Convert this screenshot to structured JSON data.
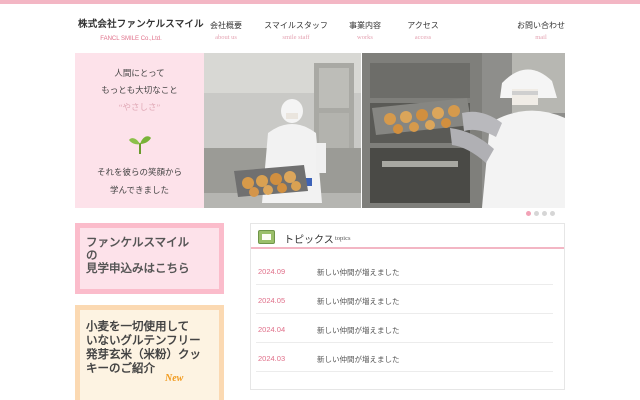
{
  "header": {
    "company_ja": "株式会社ファンケルスマイル",
    "company_en": "FANCL SMILE Co.,Ltd.",
    "nav": [
      {
        "ja": "会社概要",
        "en": "about us"
      },
      {
        "ja": "スマイルスタッフ",
        "en": "smile staff"
      },
      {
        "ja": "事業内容",
        "en": "works"
      },
      {
        "ja": "アクセス",
        "en": "access"
      },
      {
        "ja": "お問い合わせ",
        "en": "mail"
      }
    ]
  },
  "hero": {
    "lines_top": [
      "人間にとって",
      "もっとも大切なこと"
    ],
    "accent": "“やさしさ”",
    "lines_bottom": [
      "それを彼らの笑顔から",
      "学んできました"
    ],
    "slide_count": 4,
    "active_slide": 1,
    "colors": {
      "panel": "#fde2ea",
      "accent": "#e0a9b6"
    }
  },
  "banners": {
    "tour": {
      "lines": [
        "ファンケルスマイル",
        "の",
        "見学申込みはこちら"
      ]
    },
    "cookie": {
      "lines": [
        "小麦を一切使用して",
        "いないグルテンフリー",
        "発芽玄米（米粉）クッ",
        "キーのご紹介"
      ],
      "badge": "New"
    }
  },
  "topics": {
    "title": "トピックス",
    "title_en": "topics",
    "items": [
      {
        "date": "2024.09",
        "text": "新しい仲間が増えました"
      },
      {
        "date": "2024.05",
        "text": "新しい仲間が増えました"
      },
      {
        "date": "2024.04",
        "text": "新しい仲間が増えました"
      },
      {
        "date": "2024.03",
        "text": "新しい仲間が増えました"
      }
    ]
  },
  "colors": {
    "brand_pink": "#f3b6c4",
    "date_pink": "#e0708a",
    "orange": "#fbd9b2"
  }
}
